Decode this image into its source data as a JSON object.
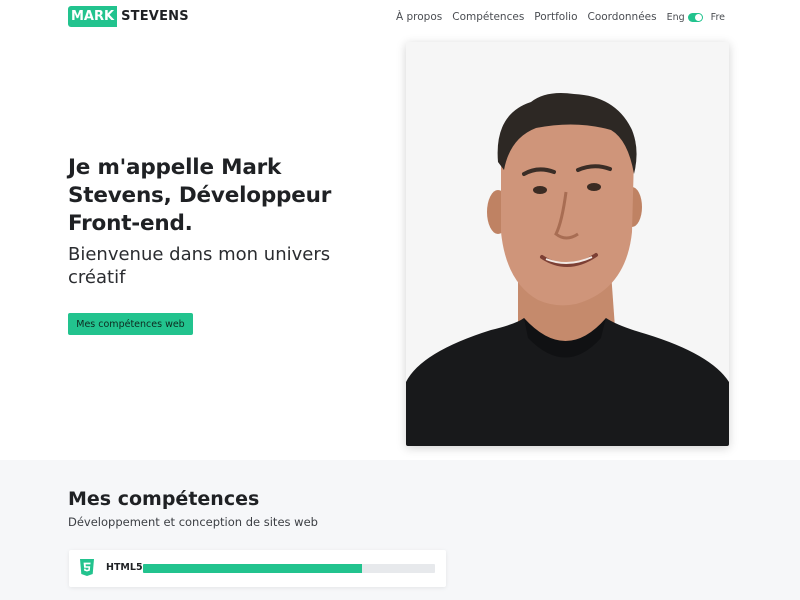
{
  "header": {
    "logo": {
      "mark": "MARK",
      "rest": "STEVENS"
    },
    "nav": [
      {
        "label": "À propos"
      },
      {
        "label": "Compétences"
      },
      {
        "label": "Portfolio"
      },
      {
        "label": "Coordonnées"
      }
    ],
    "language": {
      "left": "Eng",
      "right": "Fre"
    }
  },
  "hero": {
    "title": "Je m'appelle Mark Stevens, Développeur Front-end.",
    "subtitle": "Bienvenue dans mon univers créatif",
    "cta_label": "Mes compétences web",
    "portrait_icon": "portrait-photo"
  },
  "skills": {
    "title": "Mes compétences",
    "subtitle": "Développement et conception de sites web",
    "items": [
      {
        "name": "HTML5",
        "icon": "html5-icon",
        "level": 0.75
      }
    ]
  },
  "colors": {
    "accent": "#22c38e",
    "text": "#1f2124",
    "section_bg": "#f6f7f9"
  }
}
